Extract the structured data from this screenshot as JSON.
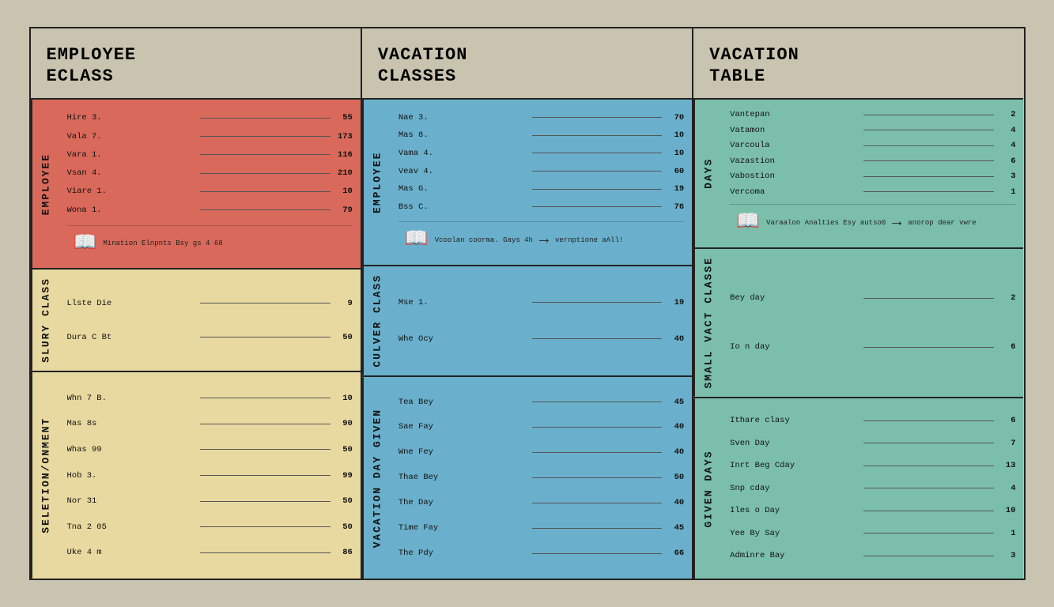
{
  "panels": [
    {
      "id": "employee-eclass",
      "header": "EMPLOYEE\nECLASS",
      "sections": [
        {
          "id": "employee-top",
          "label": "EMPLOYEE",
          "rows": [
            {
              "label": "Hire 3.",
              "value": "55"
            },
            {
              "label": "Vala 7.",
              "value": "173"
            },
            {
              "label": "Vara 1.",
              "value": "116"
            },
            {
              "label": "Vsan 4.",
              "value": "210"
            },
            {
              "label": "Viare 1.",
              "value": "10"
            },
            {
              "label": "Wona 1.",
              "value": "79"
            }
          ],
          "info": "Mination Elnpnts Bsy gs 4 68",
          "has_book": true,
          "has_arrow": false
        },
        {
          "id": "salary-class",
          "label": "SLURY CLASS",
          "rows": [
            {
              "label": "Llste Die",
              "value": "9"
            },
            {
              "label": "Dura C Bt",
              "value": "50"
            }
          ],
          "info": null
        },
        {
          "id": "selection",
          "label": "SELETION/ONMENT",
          "rows": [
            {
              "label": "Whn 7 B.",
              "value": "10"
            },
            {
              "label": "Mas 8s",
              "value": "90"
            },
            {
              "label": "Whas 99",
              "value": "50"
            },
            {
              "label": "Hob 3.",
              "value": "99"
            },
            {
              "label": "Nor 31",
              "value": "50"
            },
            {
              "label": "Tna 2 05",
              "value": "50"
            },
            {
              "label": "Uke 4 m",
              "value": "86"
            }
          ],
          "info": null
        }
      ]
    },
    {
      "id": "vacation-classes",
      "header": "VACATION\nCLASSES",
      "sections": [
        {
          "id": "vacation-top",
          "label": "EMPLOYEE",
          "rows": [
            {
              "label": "Nae 3.",
              "value": "70"
            },
            {
              "label": "Mas 8.",
              "value": "10"
            },
            {
              "label": "Vama 4.",
              "value": "10"
            },
            {
              "label": "Veav 4.",
              "value": "60"
            },
            {
              "label": "Mas G.",
              "value": "19"
            },
            {
              "label": "Bss C.",
              "value": "76"
            }
          ],
          "info": "Vcoolan coorma. Gays 4h",
          "has_book": true,
          "has_arrow": true,
          "arrow_text": "vernptione aAll!"
        },
        {
          "id": "culver-class",
          "label": "Culver CLASS",
          "rows": [
            {
              "label": "Mse 1.",
              "value": "19"
            },
            {
              "label": "Whe Ocy",
              "value": "40"
            }
          ],
          "info": null
        },
        {
          "id": "vacation-days",
          "label": "VACATION DAY\nGIVEN",
          "rows": [
            {
              "label": "Tea Bey",
              "value": "45"
            },
            {
              "label": "Sae Fay",
              "value": "40"
            },
            {
              "label": "Wne Fey",
              "value": "40"
            },
            {
              "label": "Thae Bey",
              "value": "50"
            },
            {
              "label": "The Day",
              "value": "40"
            },
            {
              "label": "Time Fay",
              "value": "45"
            },
            {
              "label": "The Pdy",
              "value": "66"
            }
          ],
          "info": null
        }
      ]
    },
    {
      "id": "vacation-table",
      "header": "VACATION\nTABLE",
      "sections": [
        {
          "id": "vac-table-top",
          "label": "DAYS",
          "rows": [
            {
              "label": "Vantepan",
              "value": "2"
            },
            {
              "label": "Vatamon",
              "value": "4"
            },
            {
              "label": "Varcoula",
              "value": "4"
            },
            {
              "label": "Vazastion",
              "value": "6"
            },
            {
              "label": "Vabostion",
              "value": "3"
            },
            {
              "label": "Vercoma",
              "value": "1"
            }
          ],
          "info": "Varaalon Analties Esy autso0",
          "has_book": true,
          "has_arrow": true,
          "arrow_text": "anorop dear vwre"
        },
        {
          "id": "vac-class-b",
          "label": "SMALL VACT CLASSE",
          "rows": [
            {
              "label": "Bey day",
              "value": "2"
            },
            {
              "label": "Io n day",
              "value": "6"
            }
          ],
          "info": null
        },
        {
          "id": "vac-class-c",
          "label": "GIVEN\nDAYS",
          "rows": [
            {
              "label": "Ithare clasy",
              "value": "6"
            },
            {
              "label": "Sven Day",
              "value": "7"
            },
            {
              "label": "Inrt Beg Cday",
              "value": "13"
            },
            {
              "label": "Snp cday",
              "value": "4"
            },
            {
              "label": "Iles o Day",
              "value": "10"
            },
            {
              "label": "Yee By Say",
              "value": "1"
            },
            {
              "label": "Adminre Bay",
              "value": "3"
            }
          ],
          "info": null
        }
      ]
    }
  ]
}
